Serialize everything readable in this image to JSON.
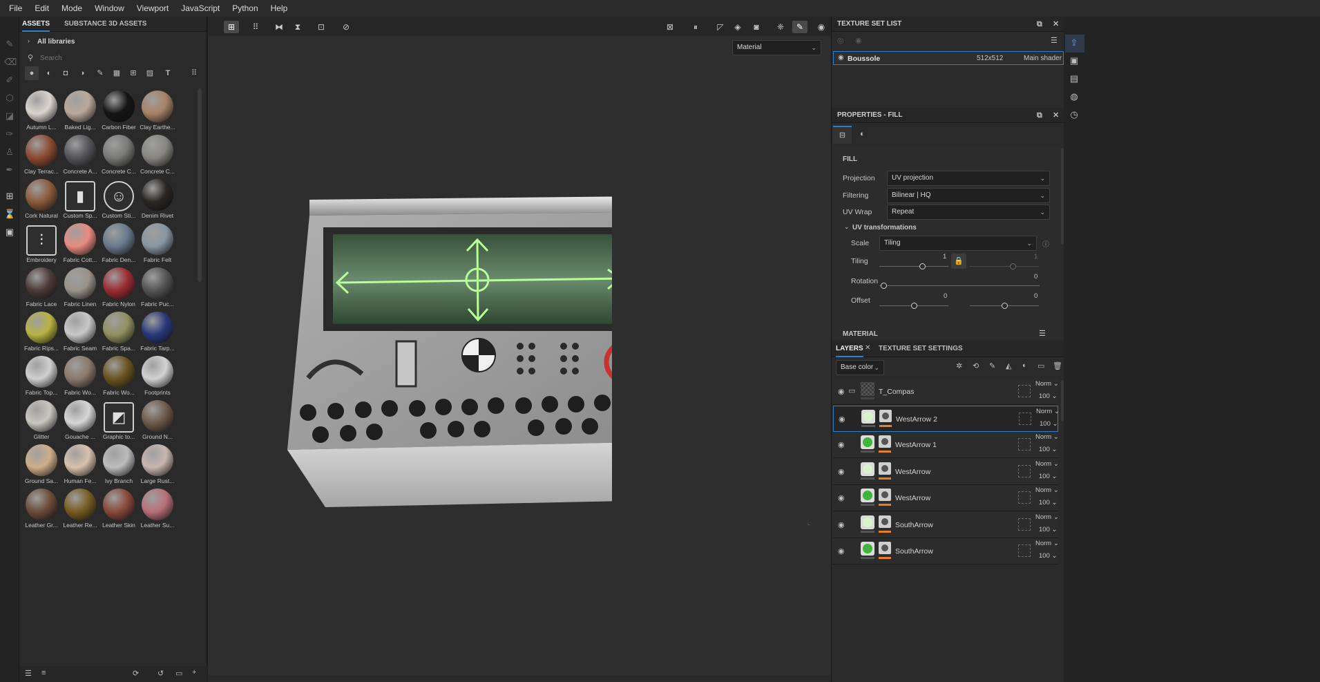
{
  "menu": [
    "File",
    "Edit",
    "Mode",
    "Window",
    "Viewport",
    "JavaScript",
    "Python",
    "Help"
  ],
  "assets": {
    "tabs": [
      "ASSETS",
      "SUBSTANCE 3D ASSETS"
    ],
    "breadcrumb": "All libraries",
    "search_placeholder": "Search",
    "items": [
      "Autumn L...",
      "Baked Lig...",
      "Carbon Fiber",
      "Clay Earthe...",
      "Clay Terrac...",
      "Concrete A...",
      "Concrete C...",
      "Concrete C...",
      "Cork Natural",
      "Custom Sp...",
      "Custom Sti...",
      "Denim Rivet",
      "Embroidery",
      "Fabric Cott...",
      "Fabric Den...",
      "Fabric Felt",
      "Fabric Lace",
      "Fabric Linen",
      "Fabric Nylon",
      "Fabric Puc...",
      "Fabric Rips...",
      "Fabric Seam",
      "Fabric Spa...",
      "Fabric Tarp...",
      "Fabric Top...",
      "Fabric Wo...",
      "Fabric Wo...",
      "Footprints",
      "Glitter",
      "Gouache ...",
      "Graphic to...",
      "Ground N...",
      "Ground Sa...",
      "Human Fe...",
      "Ivy Branch",
      "Large Rust...",
      "Leather Gr...",
      "Leather Re...",
      "Leather Skin",
      "Leather Su..."
    ],
    "colors": [
      "#d9d5cf",
      "#b9a99a",
      "#151515",
      "#a88266",
      "#8d4b33",
      "#55555a",
      "#7a7a78",
      "#878680",
      "#8b5b3c",
      "",
      "",
      "#2a2622",
      "",
      "#e98b80",
      "#697a8c",
      "#8996a2",
      "#4c3a38",
      "#9a928b",
      "#9d2c33",
      "#555",
      "#b8b342",
      "#c9c9c9",
      "#8f9160",
      "#28397a",
      "#cfcfcf",
      "#8a7a6c",
      "#6b5420",
      "#d2d2d2",
      "#c9c6bf",
      "#d7d7d7",
      "",
      "#6e5a4a",
      "#cfae89",
      "#d9c1ac",
      "#bcbcbc",
      "#c7b6b0",
      "#6d4d3a",
      "#7a5c22",
      "#8a4a3a",
      "#b8707a"
    ],
    "special": {
      "9": "custom-spray",
      "10": "custom-sticker",
      "12": "embroidery",
      "30": "graphic-tool"
    }
  },
  "viewport": {
    "material_dropdown": "Material"
  },
  "texture_set_list": {
    "title": "TEXTURE SET LIST",
    "row_name": "Boussole",
    "row_size": "512x512",
    "row_shader": "Main shader"
  },
  "properties": {
    "title": "PROPERTIES - FILL",
    "section": "FILL",
    "projection_label": "Projection",
    "projection_value": "UV projection",
    "filtering_label": "Filtering",
    "filtering_value": "Bilinear | HQ",
    "uvwrap_label": "UV Wrap",
    "uvwrap_value": "Repeat",
    "uvtrans_label": "UV transformations",
    "scale_label": "Scale",
    "scale_value": "Tiling",
    "tiling_label": "Tiling",
    "tiling_value": "1",
    "tiling_value2": "1",
    "rotation_label": "Rotation",
    "rotation_value": "0",
    "offset_label": "Offset",
    "offset_value": "0",
    "offset_value2": "0",
    "material_section": "MATERIAL"
  },
  "layers": {
    "tabs": [
      "LAYERS",
      "TEXTURE SET SETTINGS"
    ],
    "channel": "Base color",
    "items": [
      {
        "name": "T_Compas",
        "blend": "Norm",
        "opacity": "100",
        "type": "folder"
      },
      {
        "name": "WestArrow 2",
        "blend": "Norm",
        "opacity": "100",
        "fill": "#d8f3c8",
        "selected": true
      },
      {
        "name": "WestArrow 1",
        "blend": "Norm",
        "opacity": "100",
        "fill": "#3fb53a"
      },
      {
        "name": "WestArrow",
        "blend": "Norm",
        "opacity": "100",
        "fill": "#d8f3c8"
      },
      {
        "name": "WestArrow",
        "blend": "Norm",
        "opacity": "100",
        "fill": "#3fb53a"
      },
      {
        "name": "SouthArrow",
        "blend": "Norm",
        "opacity": "100",
        "fill": "#d8f3c8"
      },
      {
        "name": "SouthArrow",
        "blend": "Norm",
        "opacity": "100",
        "fill": "#3fb53a"
      }
    ]
  }
}
